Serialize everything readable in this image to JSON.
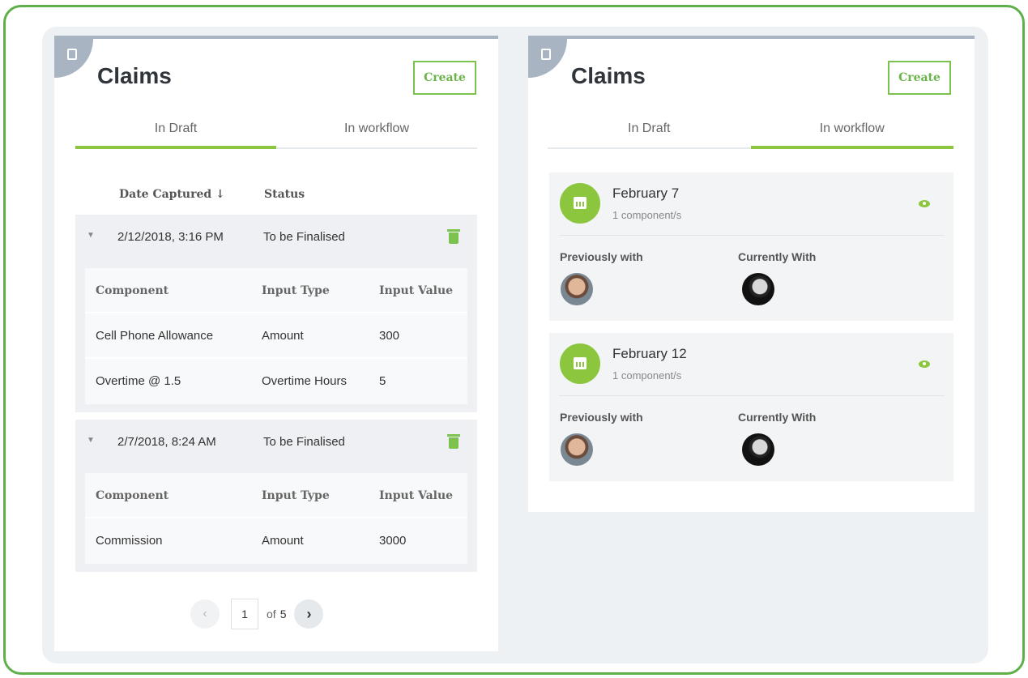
{
  "left_panel": {
    "title": "Claims",
    "create_label": "Create",
    "tabs": [
      {
        "label": "In Draft",
        "active": true
      },
      {
        "label": "In workflow",
        "active": false
      }
    ],
    "table_headers": {
      "date": "Date Captured ↓",
      "status": "Status"
    },
    "claims": [
      {
        "date": "2/12/2018, 3:16 PM",
        "status": "To be Finalised",
        "detail_headers": [
          "Component",
          "Input Type",
          "Input Value"
        ],
        "rows": [
          {
            "component": "Cell Phone Allowance",
            "input_type": "Amount",
            "input_value": "300"
          },
          {
            "component": "Overtime @ 1.5",
            "input_type": "Overtime Hours",
            "input_value": "5"
          }
        ]
      },
      {
        "date": "2/7/2018, 8:24 AM",
        "status": "To be Finalised",
        "detail_headers": [
          "Component",
          "Input Type",
          "Input Value"
        ],
        "rows": [
          {
            "component": "Commission",
            "input_type": "Amount",
            "input_value": "3000"
          }
        ]
      }
    ],
    "pagination": {
      "prev": "‹",
      "current_page": "1",
      "of": "of",
      "total": "5",
      "next": "›"
    }
  },
  "right_panel": {
    "title": "Claims",
    "create_label": "Create",
    "tabs": [
      {
        "label": "In Draft",
        "active": false
      },
      {
        "label": "In workflow",
        "active": true
      }
    ],
    "workflow_items": [
      {
        "title": "February 7",
        "subtitle": "1 component/s",
        "previously_label": "Previously with",
        "currently_label": "Currently With"
      },
      {
        "title": "February 12",
        "subtitle": "1 component/s",
        "previously_label": "Previously with",
        "currently_label": "Currently With"
      }
    ]
  },
  "colors": {
    "accent": "#8cc63f",
    "frame": "#5fb04a",
    "card_top": "#a9b4c2"
  }
}
